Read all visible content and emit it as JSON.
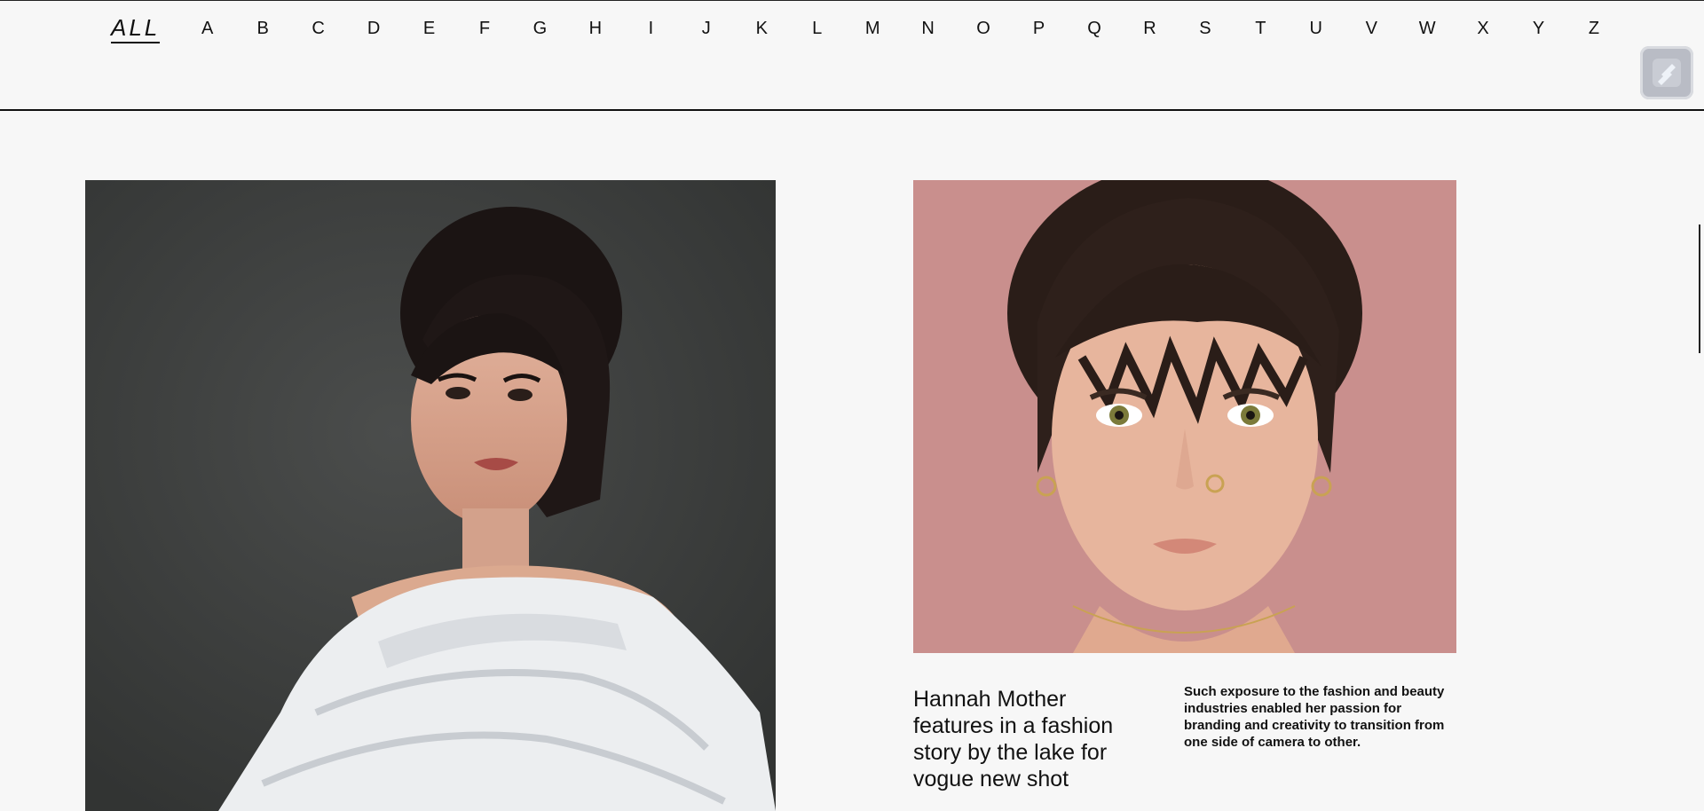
{
  "alphabet_nav": {
    "all_label": "ALL",
    "letters": [
      "A",
      "B",
      "C",
      "D",
      "E",
      "F",
      "G",
      "H",
      "I",
      "J",
      "K",
      "L",
      "M",
      "N",
      "O",
      "P",
      "Q",
      "R",
      "S",
      "T",
      "U",
      "V",
      "W",
      "X",
      "Y",
      "Z"
    ]
  },
  "floating_button": {
    "icon": "pen-icon"
  },
  "feature": {
    "headline": "Hannah Mother features in a fashion story by the lake for vogue new shot",
    "description": "Such exposure to the fashion and beauty industries enabled her passion for branding and creativity to transition from one side of camera to other."
  },
  "colors": {
    "left_photo_bg": "#3f4140",
    "right_photo_bg": "#c98f8d",
    "button_bg": "#b9bcc5",
    "button_icon": "#eef2f8"
  }
}
